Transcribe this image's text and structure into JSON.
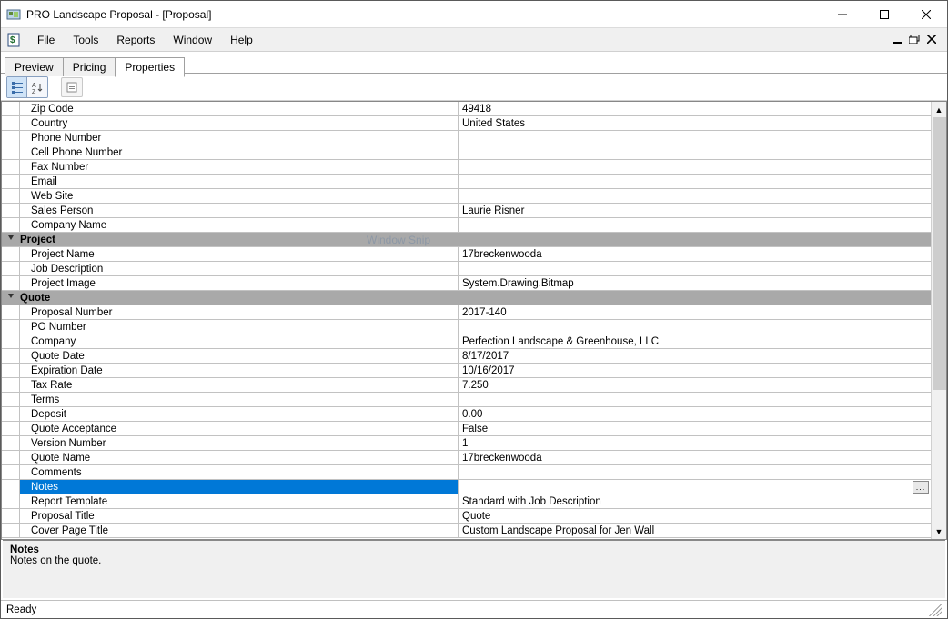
{
  "window": {
    "title": "PRO Landscape Proposal - [Proposal]"
  },
  "menu": {
    "items": [
      "File",
      "Tools",
      "Reports",
      "Window",
      "Help"
    ]
  },
  "tabs": {
    "items": [
      "Preview",
      "Pricing",
      "Properties"
    ],
    "active": "Properties"
  },
  "watermark": "Window Snip",
  "properties": [
    {
      "type": "prop",
      "label": "Zip Code",
      "value": "49418"
    },
    {
      "type": "prop",
      "label": "Country",
      "value": "United States"
    },
    {
      "type": "prop",
      "label": "Phone Number",
      "value": ""
    },
    {
      "type": "prop",
      "label": "Cell Phone Number",
      "value": ""
    },
    {
      "type": "prop",
      "label": "Fax Number",
      "value": ""
    },
    {
      "type": "prop",
      "label": "Email",
      "value": ""
    },
    {
      "type": "prop",
      "label": "Web Site",
      "value": ""
    },
    {
      "type": "prop",
      "label": "Sales Person",
      "value": "Laurie Risner"
    },
    {
      "type": "prop",
      "label": "Company Name",
      "value": ""
    },
    {
      "type": "category",
      "label": "Project"
    },
    {
      "type": "prop",
      "label": "Project Name",
      "value": "17breckenwooda"
    },
    {
      "type": "prop",
      "label": "Job Description",
      "value": ""
    },
    {
      "type": "prop",
      "label": "Project Image",
      "value": "System.Drawing.Bitmap"
    },
    {
      "type": "category",
      "label": "Quote"
    },
    {
      "type": "prop",
      "label": "Proposal Number",
      "value": "2017-140"
    },
    {
      "type": "prop",
      "label": "PO Number",
      "value": ""
    },
    {
      "type": "prop",
      "label": "Company",
      "value": "Perfection Landscape & Greenhouse, LLC"
    },
    {
      "type": "prop",
      "label": "Quote Date",
      "value": "8/17/2017"
    },
    {
      "type": "prop",
      "label": "Expiration Date",
      "value": "10/16/2017"
    },
    {
      "type": "prop",
      "label": "Tax Rate",
      "value": "7.250"
    },
    {
      "type": "prop",
      "label": "Terms",
      "value": ""
    },
    {
      "type": "prop",
      "label": "Deposit",
      "value": "0.00"
    },
    {
      "type": "prop",
      "label": "Quote Acceptance",
      "value": "False"
    },
    {
      "type": "prop",
      "label": "Version Number",
      "value": "1"
    },
    {
      "type": "prop",
      "label": "Quote Name",
      "value": "17breckenwooda"
    },
    {
      "type": "prop",
      "label": "Comments",
      "value": ""
    },
    {
      "type": "prop",
      "label": "Notes",
      "value": "",
      "selected": true,
      "hasEllipsis": true
    },
    {
      "type": "prop",
      "label": "Report Template",
      "value": "Standard with Job Description"
    },
    {
      "type": "prop",
      "label": "Proposal Title",
      "value": "Quote"
    },
    {
      "type": "prop",
      "label": "Cover Page Title",
      "value": "Custom Landscape Proposal for Jen Wall"
    }
  ],
  "description": {
    "title": "Notes",
    "text": "Notes on the quote."
  },
  "status": {
    "text": "Ready"
  }
}
